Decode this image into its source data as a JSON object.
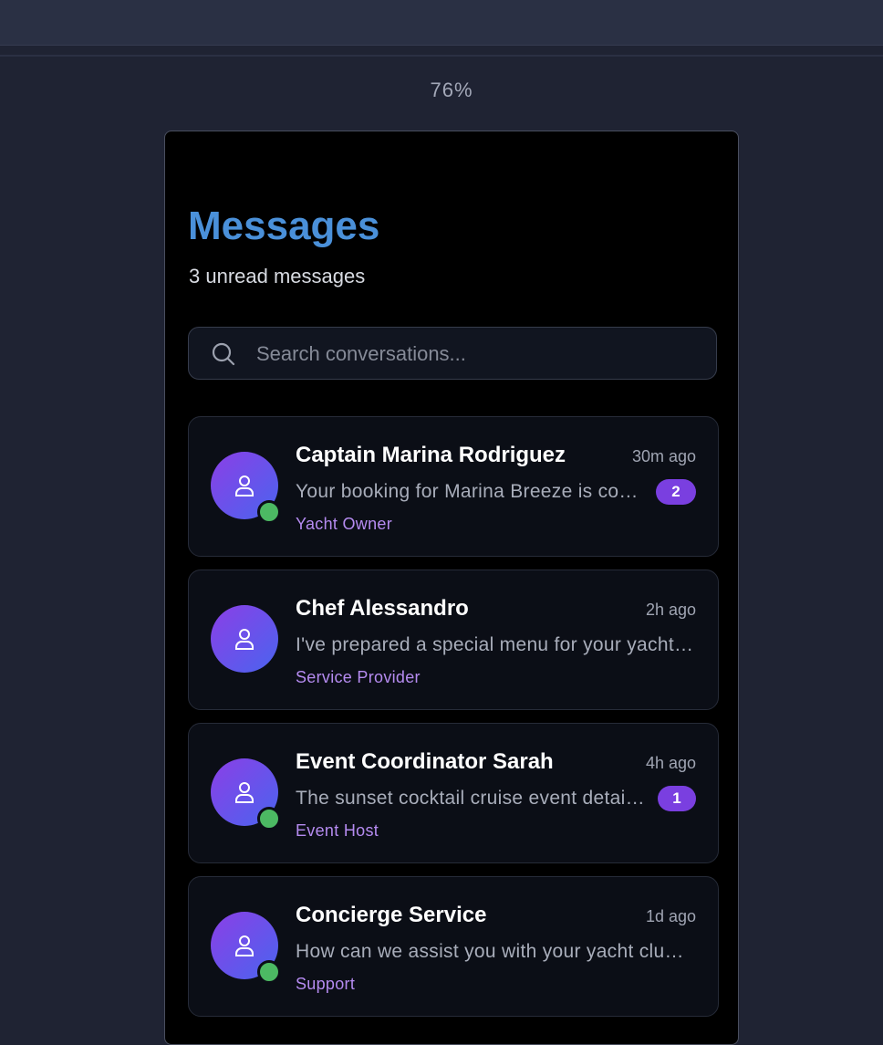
{
  "zoom_label": "76%",
  "header": {
    "title": "Messages",
    "subtitle": "3 unread messages"
  },
  "search": {
    "placeholder": "Search conversations...",
    "value": ""
  },
  "icons": {
    "search": "search-icon",
    "avatar": "user-icon",
    "status": "online-indicator"
  },
  "colors": {
    "title": "#4a90d9",
    "accent": "#7a3fe0",
    "role": "#b58bf0",
    "online": "#4cb963",
    "avatar_gradient_start": "#8b3fe6",
    "avatar_gradient_end": "#4a64ef"
  },
  "conversations": [
    {
      "name": "Captain Marina Rodriguez",
      "time": "30m ago",
      "preview": "Your booking for Marina Breeze is confirmed for tomorrow",
      "role": "Yacht Owner",
      "unread": "2",
      "online": true
    },
    {
      "name": "Chef Alessandro",
      "time": "2h ago",
      "preview": "I've prepared a special menu for your yacht party",
      "role": "Service Provider",
      "unread": "",
      "online": false
    },
    {
      "name": "Event Coordinator Sarah",
      "time": "4h ago",
      "preview": "The sunset cocktail cruise event details are ready",
      "role": "Event Host",
      "unread": "1",
      "online": true
    },
    {
      "name": "Concierge Service",
      "time": "1d ago",
      "preview": "How can we assist you with your yacht club experience?",
      "role": "Support",
      "unread": "",
      "online": true
    }
  ]
}
